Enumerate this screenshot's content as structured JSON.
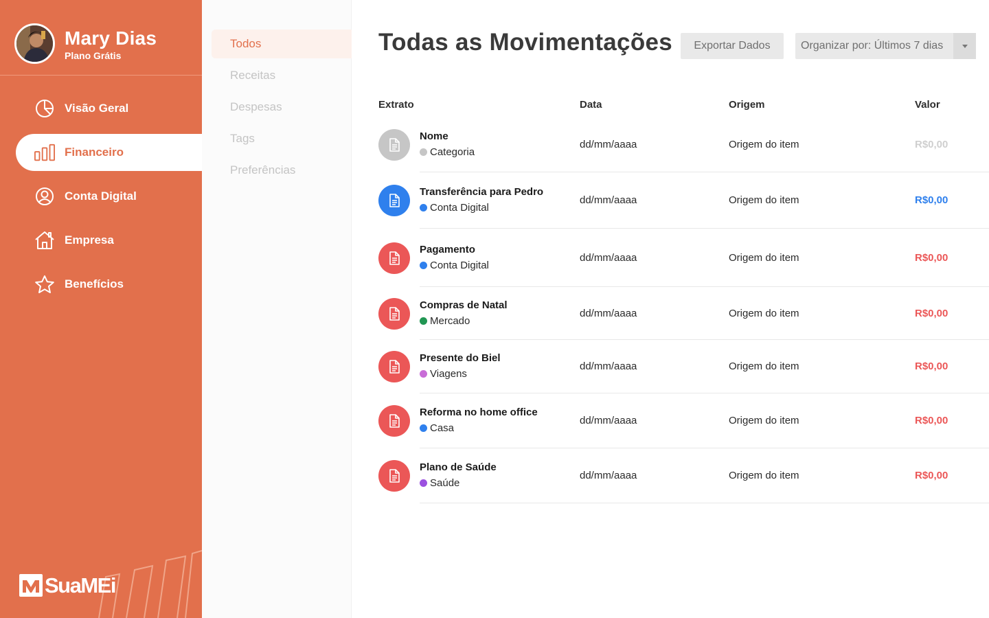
{
  "profile": {
    "name": "Mary Dias",
    "plan": "Plano Grátis"
  },
  "sidebar": {
    "items": [
      {
        "label": "Visão Geral",
        "icon": "pie-chart-icon"
      },
      {
        "label": "Financeiro",
        "icon": "bar-chart-icon",
        "active": true
      },
      {
        "label": "Conta Digital",
        "icon": "user-circle-icon"
      },
      {
        "label": "Empresa",
        "icon": "house-icon"
      },
      {
        "label": "Benefícios",
        "icon": "star-icon"
      }
    ],
    "brand": "SuaMEi"
  },
  "submenu": {
    "items": [
      {
        "label": "Todos",
        "active": true
      },
      {
        "label": "Receitas"
      },
      {
        "label": "Despesas"
      },
      {
        "label": "Tags"
      },
      {
        "label": "Preferências"
      }
    ]
  },
  "main": {
    "title": "Todas as Movimentações",
    "export_label": "Exportar Dados",
    "sort_label": "Organizar por: Últimos 7 dias",
    "columns": {
      "extrato": "Extrato",
      "data": "Data",
      "origem": "Origem",
      "valor": "Valor"
    },
    "rows": [
      {
        "name": "Nome",
        "category": "Categoria",
        "category_color": "#c6c6c6",
        "icon_color": "#c6c6c6",
        "date": "dd/mm/aaaa",
        "origin": "Origem do item",
        "value": "R$0,00",
        "value_color": "#cfcfcf"
      },
      {
        "name": "Transferência para Pedro",
        "category": "Conta Digital",
        "category_color": "#2f80ed",
        "icon_color": "#2f80ed",
        "date": "dd/mm/aaaa",
        "origin": "Origem do item",
        "value": "R$0,00",
        "value_color": "#2f80ed"
      },
      {
        "name": "Pagamento",
        "category": "Conta Digital",
        "category_color": "#2f80ed",
        "icon_color": "#eb5757",
        "date": "dd/mm/aaaa",
        "origin": "Origem do item",
        "value": "R$0,00",
        "value_color": "#eb5757"
      },
      {
        "name": "Compras de Natal",
        "category": "Mercado",
        "category_color": "#219653",
        "icon_color": "#eb5757",
        "date": "dd/mm/aaaa",
        "origin": "Origem do item",
        "value": "R$0,00",
        "value_color": "#eb5757"
      },
      {
        "name": "Presente do Biel",
        "category": "Viagens",
        "category_color": "#c86dd7",
        "icon_color": "#eb5757",
        "date": "dd/mm/aaaa",
        "origin": "Origem do item",
        "value": "R$0,00",
        "value_color": "#eb5757"
      },
      {
        "name": "Reforma no home office",
        "category": "Casa",
        "category_color": "#2f80ed",
        "icon_color": "#eb5757",
        "date": "dd/mm/aaaa",
        "origin": "Origem do item",
        "value": "R$0,00",
        "value_color": "#eb5757"
      },
      {
        "name": "Plano de Saúde",
        "category": "Saúde",
        "category_color": "#9b51e0",
        "icon_color": "#eb5757",
        "date": "dd/mm/aaaa",
        "origin": "Origem do item",
        "value": "R$0,00",
        "value_color": "#eb5757"
      }
    ]
  },
  "colors": {
    "brand": "#e2704c",
    "active_bg": "#fdf1ec",
    "muted": "#c4c4c4"
  }
}
